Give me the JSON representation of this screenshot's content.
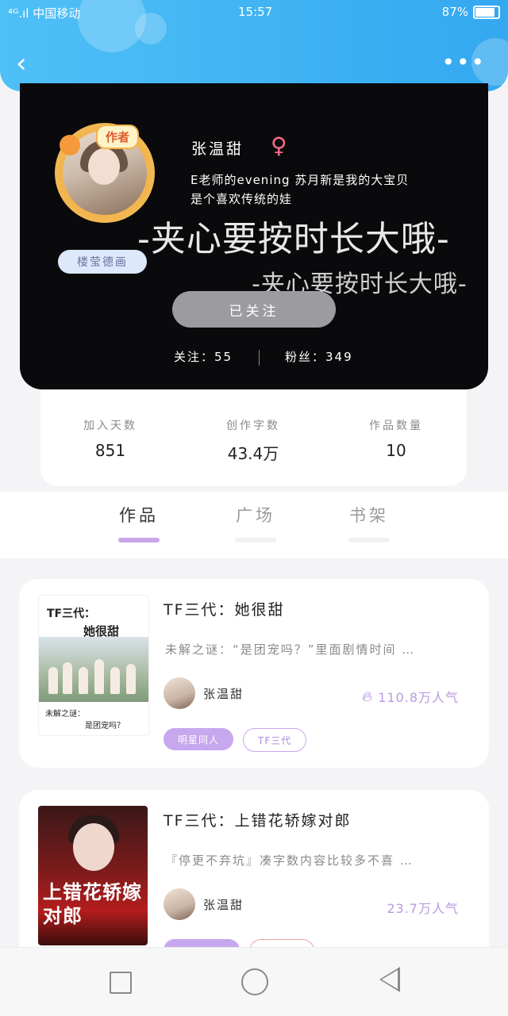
{
  "status_bar": {
    "carrier": "⁴ᴳ.ıl 中国移动",
    "time": "15:57",
    "battery": "87%"
  },
  "header": {
    "back_label": "‹",
    "more_label": "•••"
  },
  "profile": {
    "author_badge": "作者",
    "tag": "楼莹德画",
    "username": "张温甜",
    "gender_symbol": "♀",
    "bio_line1": "E老师的evening 苏月新是我的大宝贝",
    "bio_line2": "是个喜欢传统的娃",
    "deco_line1": "-夹心要按时长大哦-",
    "deco_line2": "-夹心要按时长大哦-",
    "follow_button": "已关注",
    "following": "关注：55",
    "fans": "粉丝：349"
  },
  "stats": [
    {
      "label": "加入天数",
      "value": "851"
    },
    {
      "label": "创作字数",
      "value": "43.4万"
    },
    {
      "label": "作品数量",
      "value": "10"
    }
  ],
  "tabs": [
    {
      "label": "作品"
    },
    {
      "label": "广场"
    },
    {
      "label": "书架"
    }
  ],
  "works": [
    {
      "title": "TF三代：她很甜",
      "desc": "未解之谜：“是团宠吗？”里面剧情时间 …",
      "author": "张温甜",
      "popularity": "110.8万人气",
      "cover_title": "TF三代：",
      "cover_title2": "她很甜",
      "cover_foot1": "未解之谜：",
      "cover_foot2": "是团宠吗？",
      "tags": [
        "明星同人",
        "TF三代"
      ]
    },
    {
      "title": "TF三代：上错花轿嫁对郎",
      "desc": "『停更不弃坑』凑字数内容比较多不喜 …",
      "author": "张温甜",
      "popularity": "23.7万人气",
      "cover_text": "上错花轿嫁对郎"
    }
  ]
}
